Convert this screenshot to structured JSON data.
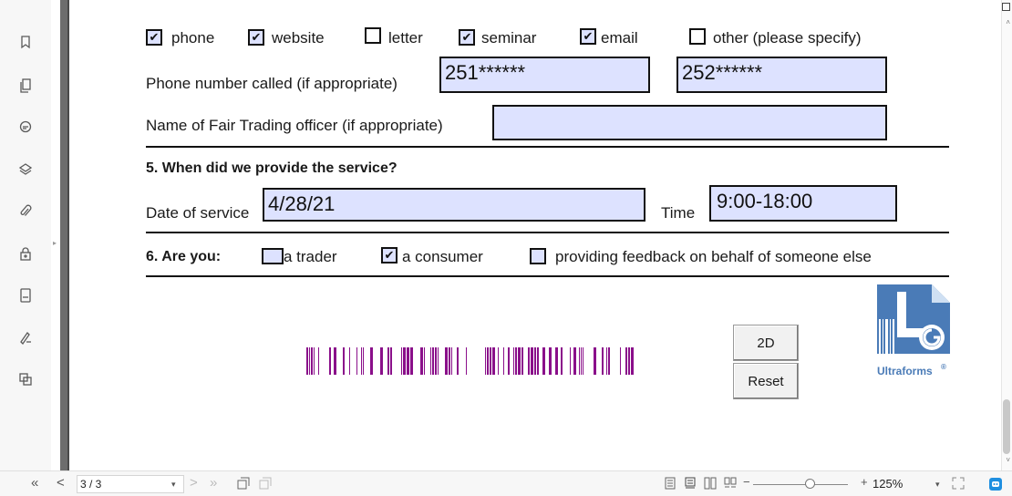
{
  "contact_methods": {
    "phone": {
      "label": "phone",
      "checked": true
    },
    "website": {
      "label": "website",
      "checked": true
    },
    "letter": {
      "label": "letter",
      "checked": false
    },
    "seminar": {
      "label": "seminar",
      "checked": true
    },
    "email": {
      "label": "email",
      "checked": true
    },
    "other": {
      "label": "other (please specify)",
      "checked": false
    },
    "check_glyph": "✔"
  },
  "phone_called": {
    "label": "Phone number called (if appropriate)",
    "value1": "251******",
    "value2": "252******"
  },
  "officer": {
    "label": "Name of Fair Trading officer (if appropriate)",
    "value": ""
  },
  "section5": {
    "heading": "5.  When did we provide the service?",
    "date_label": "Date of service",
    "date_value": "4/28/21",
    "time_label": "Time",
    "time_value": "9:00-18:00"
  },
  "section6": {
    "heading": "6.  Are you:",
    "trader": {
      "label": "a trader",
      "checked": false
    },
    "consumer": {
      "label": "a consumer",
      "checked": true
    },
    "behalf": {
      "label": "providing feedback on behalf of someone else",
      "checked": false
    }
  },
  "buttons": {
    "two_d": "2D",
    "reset": "Reset"
  },
  "logo": {
    "text": "Ultraforms",
    "mark": "®",
    "color": "#4a7bb7"
  },
  "barcode": {
    "color": "#8a0f8a"
  },
  "bottom_bar": {
    "first": "«",
    "prev": "<",
    "page": "3 / 3",
    "next": ">",
    "last": "»",
    "zoom_minus": "−",
    "zoom_plus": "+",
    "zoom_value": "125%",
    "zoom_level_percent": 125
  }
}
